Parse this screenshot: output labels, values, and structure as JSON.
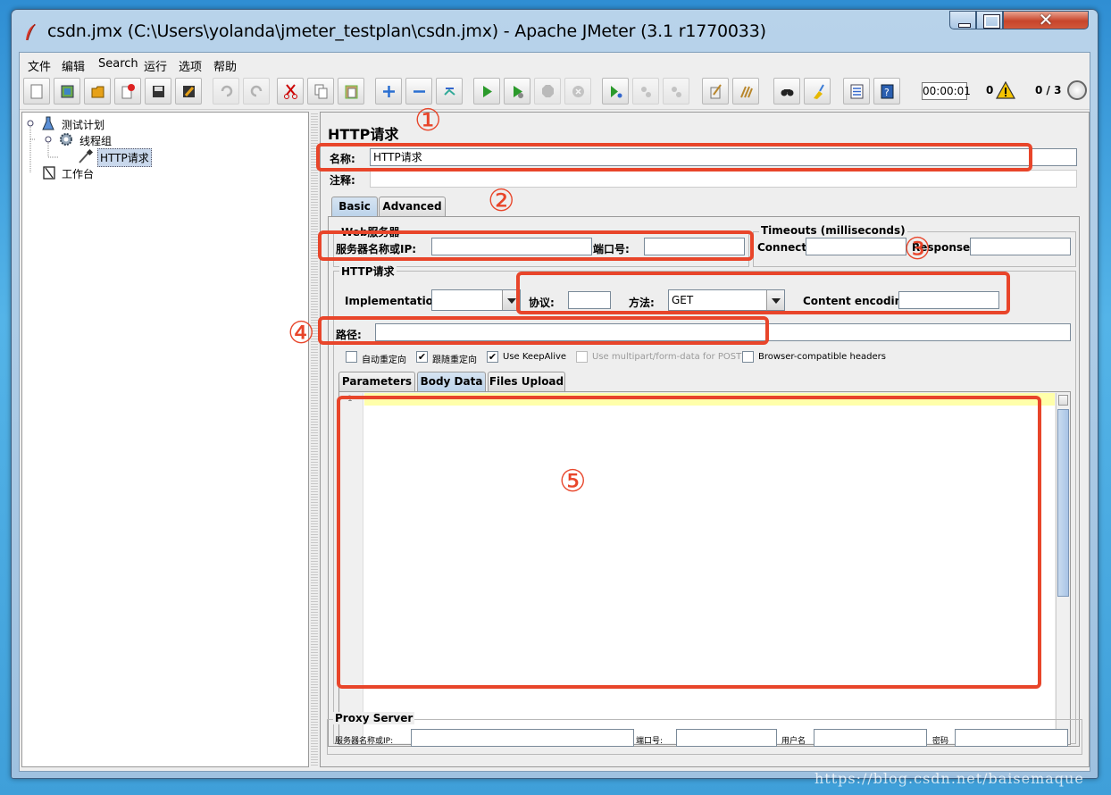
{
  "window": {
    "title": "csdn.jmx (C:\\Users\\yolanda\\jmeter_testplan\\csdn.jmx) - Apache JMeter (3.1 r1770033)"
  },
  "menu": {
    "items": [
      "文件",
      "编辑",
      "Search",
      "运行",
      "选项",
      "帮助"
    ]
  },
  "toolbar": {
    "icons": [
      "new-icon",
      "templates-icon",
      "open-icon",
      "close-icon",
      "save-icon",
      "save-as-icon",
      "undo-icon",
      "redo-icon",
      "cut-icon",
      "copy-icon",
      "paste-icon",
      "expand-icon",
      "collapse-icon",
      "toggle-icon",
      "start-icon",
      "start-no-pause-icon",
      "stop-icon",
      "shutdown-icon",
      "remote-start-icon",
      "remote-stop-icon",
      "remote-shutdown-icon",
      "clear-icon",
      "clear-all-icon",
      "search-icon",
      "reset-search-icon",
      "function-helper-icon",
      "help-icon"
    ],
    "timer": "00:00:01",
    "error_count": "0",
    "threads": "0 / 3"
  },
  "tree": {
    "items": [
      "测试计划",
      "线程组",
      "HTTP请求",
      "工作台"
    ]
  },
  "panel": {
    "title": "HTTP请求",
    "name_label": "名称:",
    "name_value": "HTTP请求",
    "comment_label": "注释:",
    "tabs": [
      "Basic",
      "Advanced"
    ],
    "web_server": {
      "legend": "Web服务器",
      "server_label": "服务器名称或IP:",
      "port_label": "端口号:"
    },
    "timeouts": {
      "legend": "Timeouts (milliseconds)",
      "connect_label": "Connect:",
      "response_label": "Response:"
    },
    "http_request": {
      "legend": "HTTP请求",
      "implementation_label": "Implementation:",
      "protocol_label": "协议:",
      "method_label": "方法:",
      "method_value": "GET",
      "encoding_label": "Content encoding:",
      "path_label": "路径:"
    },
    "options": [
      {
        "label": "自动重定向",
        "checked": false,
        "enabled": true
      },
      {
        "label": "跟随重定向",
        "checked": true,
        "enabled": true
      },
      {
        "label": "Use KeepAlive",
        "checked": true,
        "enabled": true
      },
      {
        "label": "Use multipart/form-data for POST",
        "checked": false,
        "enabled": false
      },
      {
        "label": "Browser-compatible headers",
        "checked": false,
        "enabled": true
      }
    ],
    "body_tabs": [
      "Parameters",
      "Body Data",
      "Files Upload"
    ],
    "editor_line": "1",
    "proxy": {
      "legend": "Proxy Server",
      "server_label": "服务器名称或IP:",
      "port_label": "端口号:",
      "user_label": "用户名",
      "password_label": "密码"
    }
  },
  "annotations": [
    "①",
    "②",
    "③",
    "④",
    "⑤"
  ],
  "watermark": "https://blog.csdn.net/baisemaque",
  "colors": {
    "annotation": "#e8452a",
    "selection": "#c9d8ec",
    "editor_highlight": "#ffffaa"
  }
}
